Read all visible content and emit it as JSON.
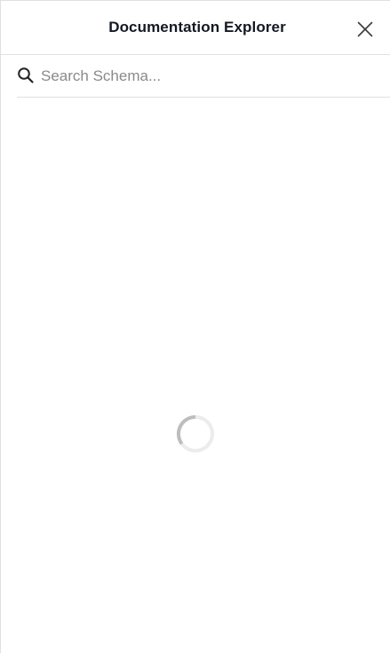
{
  "header": {
    "title": "Documentation Explorer"
  },
  "search": {
    "placeholder": "Search Schema..."
  },
  "icons": {
    "close": "close-icon",
    "search": "search-icon",
    "spinner": "loading-spinner"
  }
}
